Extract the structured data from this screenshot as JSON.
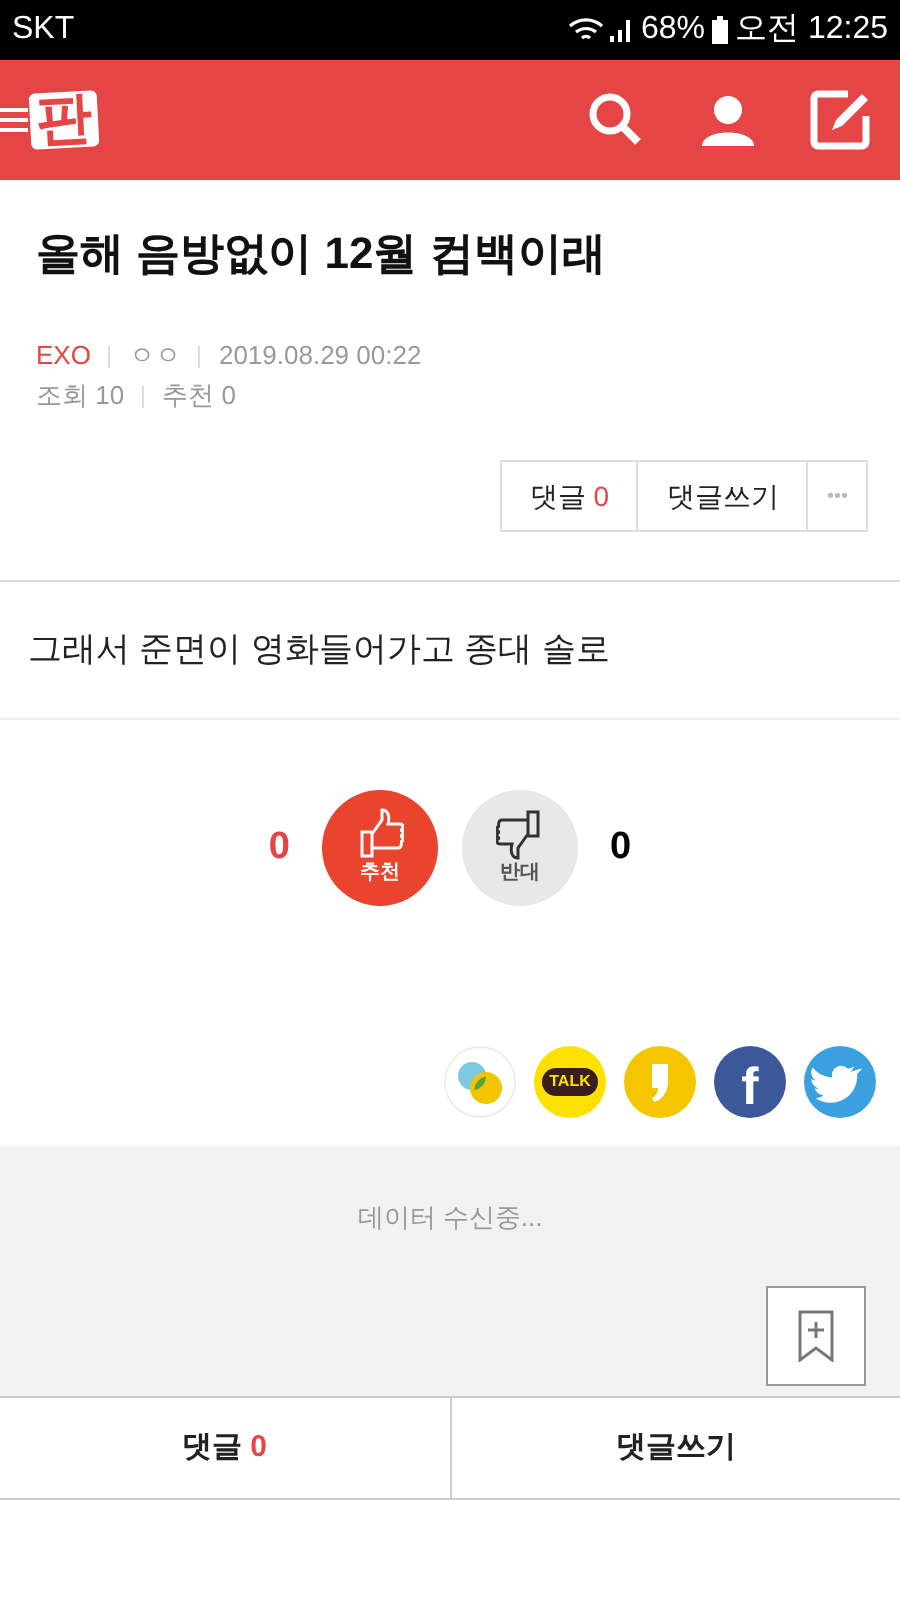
{
  "status_bar": {
    "carrier": "SKT",
    "battery": "68%",
    "time": "오전 12:25"
  },
  "header": {
    "logo": "판"
  },
  "post": {
    "title": "올해 음방없이 12월 컴백이래",
    "category": "EXO",
    "author": "ㅇㅇ",
    "date": "2019.08.29 00:22",
    "views": "조회 10",
    "recommends": "추천 0"
  },
  "actions": {
    "comment_label": "댓글",
    "comment_count": "0",
    "write": "댓글쓰기",
    "more": "•••"
  },
  "body": "그래서 준면이 영화들어가고 종대 솔로",
  "vote": {
    "up_count": "0",
    "up_label": "추천",
    "down_label": "반대",
    "down_count": "0"
  },
  "share": [
    {
      "kind": "bubbles"
    },
    {
      "kind": "talk",
      "label": "TALK"
    },
    {
      "kind": "story"
    },
    {
      "kind": "facebook",
      "label": "f"
    },
    {
      "kind": "twitter"
    }
  ],
  "loading": "데이터 수신중...",
  "bottom_bar": {
    "comment_label": "댓글",
    "comment_count": "0",
    "write": "댓글쓰기"
  }
}
